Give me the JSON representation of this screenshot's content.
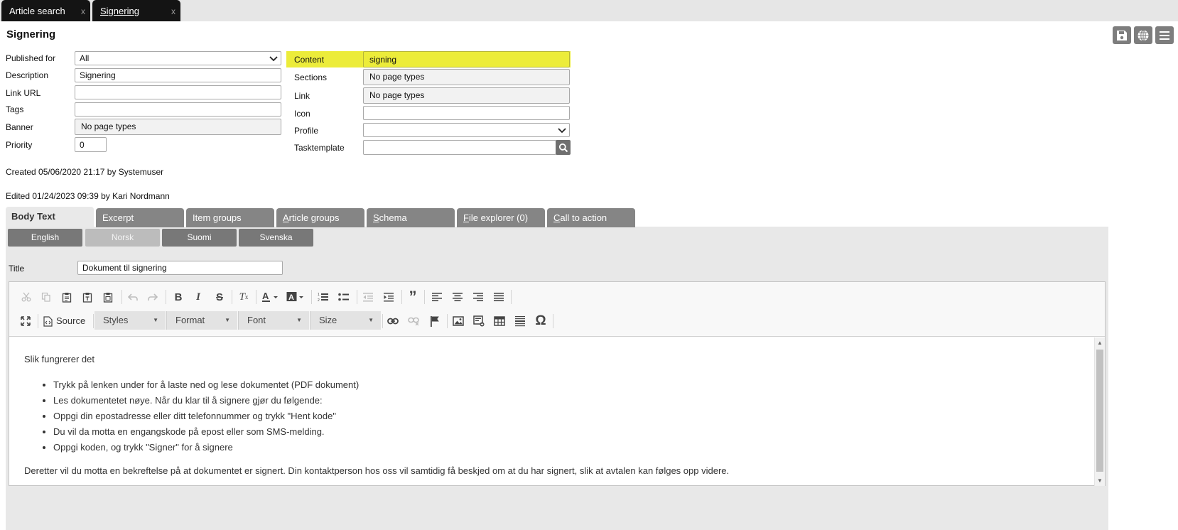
{
  "tabs": [
    {
      "label": "Article search",
      "close": "x"
    },
    {
      "label": "Signering",
      "close": "x"
    }
  ],
  "page_title": "Signering",
  "header_icons": [
    "save-icon",
    "globe-icon",
    "menu-icon"
  ],
  "form_left": {
    "published_for": {
      "label": "Published for",
      "value": "All"
    },
    "description": {
      "label": "Description",
      "value": "Signering"
    },
    "link_url": {
      "label": "Link URL",
      "value": ""
    },
    "tags": {
      "label": "Tags",
      "value": ""
    },
    "banner": {
      "label": "Banner",
      "value": "No page types"
    },
    "priority": {
      "label": "Priority",
      "value": "0"
    }
  },
  "form_right": {
    "content": {
      "label": "Content",
      "value": "signing"
    },
    "sections": {
      "label": "Sections",
      "value": "No page types"
    },
    "link": {
      "label": "Link",
      "value": "No page types"
    },
    "icon": {
      "label": "Icon",
      "value": ""
    },
    "profile": {
      "label": "Profile",
      "value": ""
    },
    "tasktemplate": {
      "label": "Tasktemplate",
      "value": ""
    }
  },
  "meta": {
    "created": "Created 05/06/2020 21:17 by Systemuser",
    "edited": "Edited 01/24/2023 09:39 by Kari Nordmann"
  },
  "section_tabs": [
    {
      "key": "B",
      "rest": "ody Text",
      "active": true
    },
    {
      "key": "E",
      "rest": "xcerpt"
    },
    {
      "key": "I",
      "rest": "tem groups"
    },
    {
      "key": "A",
      "rest": "rticle groups"
    },
    {
      "key": "S",
      "rest": "chema"
    },
    {
      "key": "F",
      "rest": "ile explorer (0)"
    },
    {
      "key": "C",
      "rest": "all to action"
    }
  ],
  "languages": [
    {
      "label": "English"
    },
    {
      "label": "Norsk",
      "active": true
    },
    {
      "label": "Suomi"
    },
    {
      "label": "Svenska"
    }
  ],
  "title_field": {
    "label": "Title",
    "value": "Dokument til signering"
  },
  "editor": {
    "source_label": "Source",
    "combos": {
      "styles": "Styles",
      "format": "Format",
      "font": "Font",
      "size": "Size"
    },
    "content": {
      "intro": "Slik fungrerer det",
      "bullets": [
        "Trykk på lenken under for å laste ned og lese dokumentet (PDF dokument)",
        "Les dokumentetet nøye.  Når du klar til å signere gjør du følgende:",
        "Oppgi din epostadresse eller ditt telefonnummer og trykk \"Hent kode\"",
        "Du vil da motta en engangskode på epost eller som SMS-melding.",
        "Oppgi koden, og trykk \"Signer\" for å signere"
      ],
      "outro": "Deretter vil du motta en bekreftelse på at dokumentet er signert.  Din kontaktperson hos oss vil samtidig få beskjed om at du har signert, slik at avtalen kan følges opp videre."
    }
  },
  "colors": {
    "highlight": "#ecec3a",
    "tab_dark": "#141414",
    "tab_gray": "#858585"
  }
}
